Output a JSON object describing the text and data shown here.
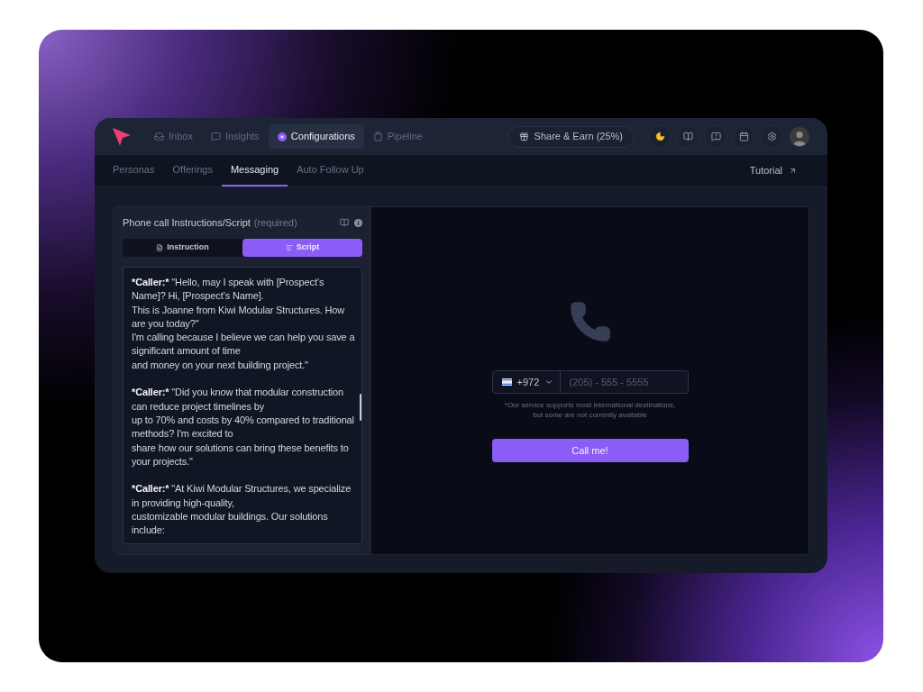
{
  "nav": {
    "items": [
      {
        "label": "Inbox",
        "selected": false
      },
      {
        "label": "Insights",
        "selected": false
      },
      {
        "label": "Configurations",
        "selected": true
      },
      {
        "label": "Pipeline",
        "selected": false
      }
    ]
  },
  "share_button": {
    "label": "Share & Earn (25%)"
  },
  "subnav": {
    "tabs": [
      {
        "label": "Personas",
        "selected": false
      },
      {
        "label": "Offerings",
        "selected": false
      },
      {
        "label": "Messaging",
        "selected": true
      },
      {
        "label": "Auto Follow Up",
        "selected": false
      }
    ],
    "tutorial_link": "Tutorial"
  },
  "script_panel": {
    "title": "Phone call Instructions/Script",
    "hint": "(required)",
    "modes": [
      {
        "label": "Instruction",
        "selected": false
      },
      {
        "label": "Script",
        "selected": true
      }
    ],
    "paragraphs": [
      {
        "speaker": "*Caller:*",
        "lines": [
          "\"Hello, may I speak with [Prospect’s Name]? Hi, [Prospect’s Name].",
          "This is Joanne from Kiwi Modular Structures. How are you today?\"",
          "I'm calling because I believe we can help you save a significant amount of time",
          "and money on your next building project.\""
        ]
      },
      {
        "speaker": "*Caller:*",
        "lines": [
          "\"Did you know that modular construction can reduce project timelines by",
          "up to 70% and costs by 40% compared to traditional methods? I'm excited to",
          "share how our solutions can bring these benefits to your projects.\""
        ]
      },
      {
        "speaker": "*Caller:*",
        "lines": [
          "\"At Kiwi Modular Structures, we specialize in providing high-quality,",
          "customizable modular buildings. Our solutions include:"
        ]
      }
    ]
  },
  "call_panel": {
    "country_code": "+972",
    "phone_placeholder": "(205) - 555 - 5555",
    "note": "*Our service supports most international destinations, but some are not currently available",
    "call_button": "Call me!"
  }
}
